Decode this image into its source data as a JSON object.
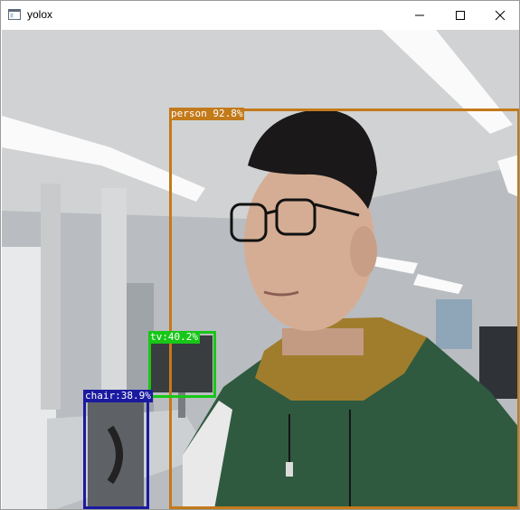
{
  "window": {
    "title": "yolox",
    "icons": {
      "app": "window-app-icon",
      "minimize": "minimize-icon",
      "maximize": "maximize-icon",
      "close": "close-icon"
    }
  },
  "detections": [
    {
      "label": "person 92.8%",
      "color": "#c37a1a"
    },
    {
      "label": "tv:40.2%",
      "color": "#17c717"
    },
    {
      "label": "chair:38.9%",
      "color": "#1a1aa0"
    }
  ]
}
